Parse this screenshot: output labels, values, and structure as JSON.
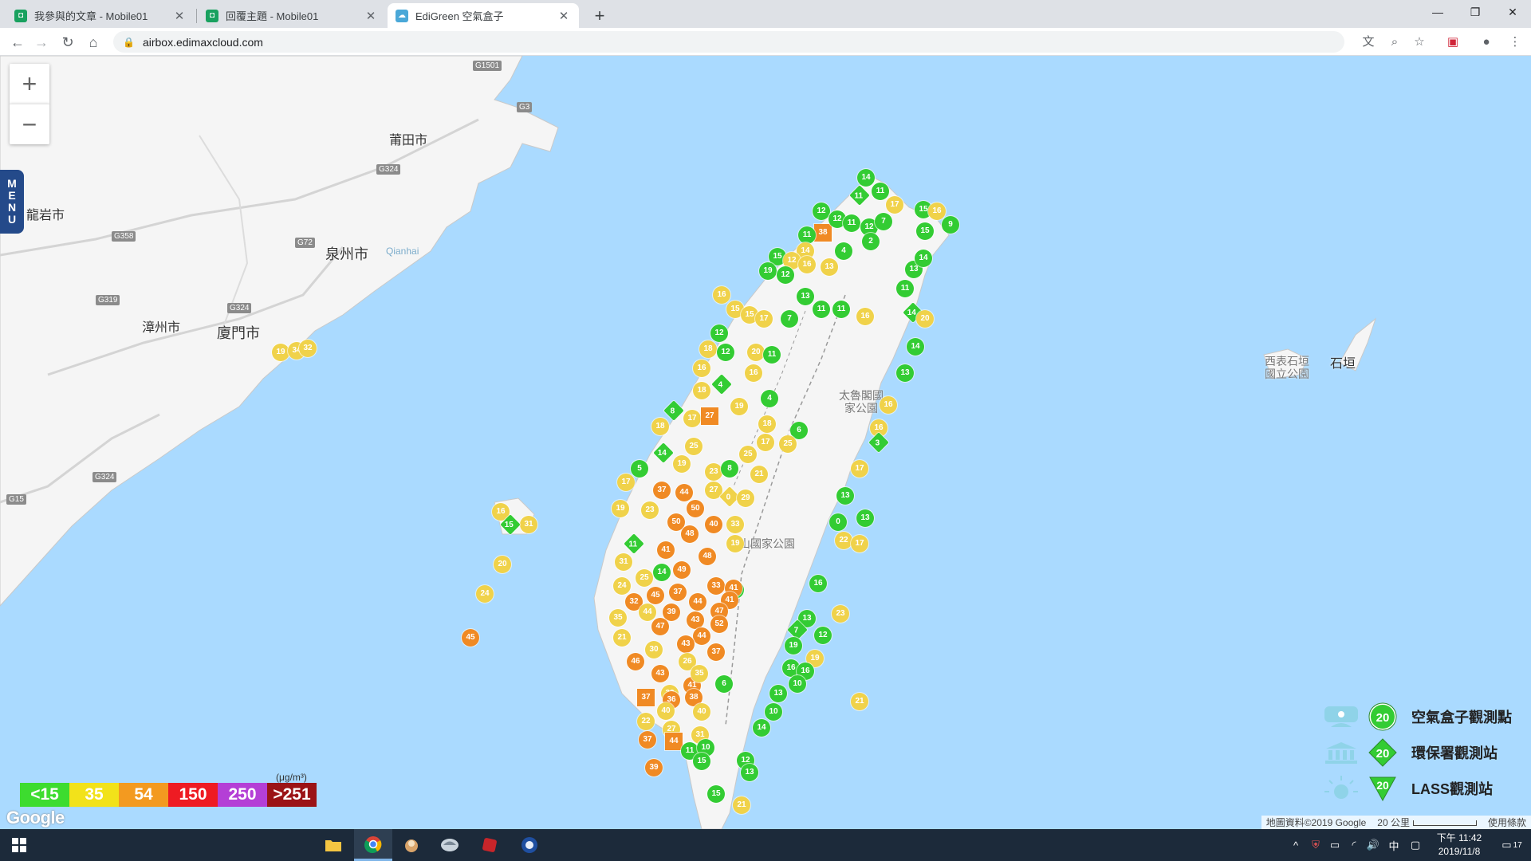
{
  "browser": {
    "tabs": [
      {
        "title": "我參與的文章 - Mobile01",
        "active": false
      },
      {
        "title": "回覆主題 - Mobile01",
        "active": false
      },
      {
        "title": "EdiGreen 空氣盒子",
        "active": true
      }
    ],
    "new_tab_label": "+",
    "window_controls": {
      "minimize": "—",
      "maximize": "❐",
      "close": "✕"
    },
    "url": "airbox.edimaxcloud.com"
  },
  "map": {
    "zoom_in_label": "+",
    "zoom_out_label": "−",
    "menu_letters": [
      "M",
      "E",
      "N",
      "U"
    ],
    "cities": [
      "莆田市",
      "龍岩市",
      "泉州市",
      "漳州市",
      "廈門市",
      "石垣",
      "西表石垣國立公園",
      "Qianhai"
    ],
    "roads": [
      "G1501",
      "G3",
      "G324",
      "G358",
      "G72",
      "G319",
      "G324",
      "G324",
      "G15"
    ],
    "parks": [
      "太魯閣國家公園",
      "山國家公園"
    ],
    "aqi_scale": [
      {
        "label": "<15",
        "color": "#3ddc2f"
      },
      {
        "label": "35",
        "color": "#f2e21a"
      },
      {
        "label": "54",
        "color": "#f39a20"
      },
      {
        "label": "150",
        "color": "#ee1b23"
      },
      {
        "label": "250",
        "color": "#b43fd6"
      },
      {
        "label": ">251",
        "color": "#9b1316"
      }
    ],
    "aqi_unit": "(μg/m³)",
    "google_logo": "Google",
    "legend": [
      {
        "label": "空氣盒子觀測點",
        "value": "20",
        "shape": "circle",
        "icon": "airbox-icon"
      },
      {
        "label": "環保署觀測站",
        "value": "20",
        "shape": "diamond",
        "icon": "government-building-icon"
      },
      {
        "label": "LASS觀測站",
        "value": "20",
        "shape": "triangle",
        "icon": "lass-station-icon"
      }
    ],
    "attribution": {
      "data": "地圖資料©2019 Google",
      "scale": "20 公里",
      "terms": "使用條款"
    },
    "colors": {
      "green": "#33cc33",
      "yellow": "#f0d24a",
      "orange": "#f08a24",
      "red": "#e12a2a",
      "water": "#aadaff",
      "land": "#f5f5f5"
    }
  },
  "taskbar": {
    "time": "下午 11:42",
    "date": "2019/11/8",
    "ime": "中",
    "notification_count": "17"
  }
}
